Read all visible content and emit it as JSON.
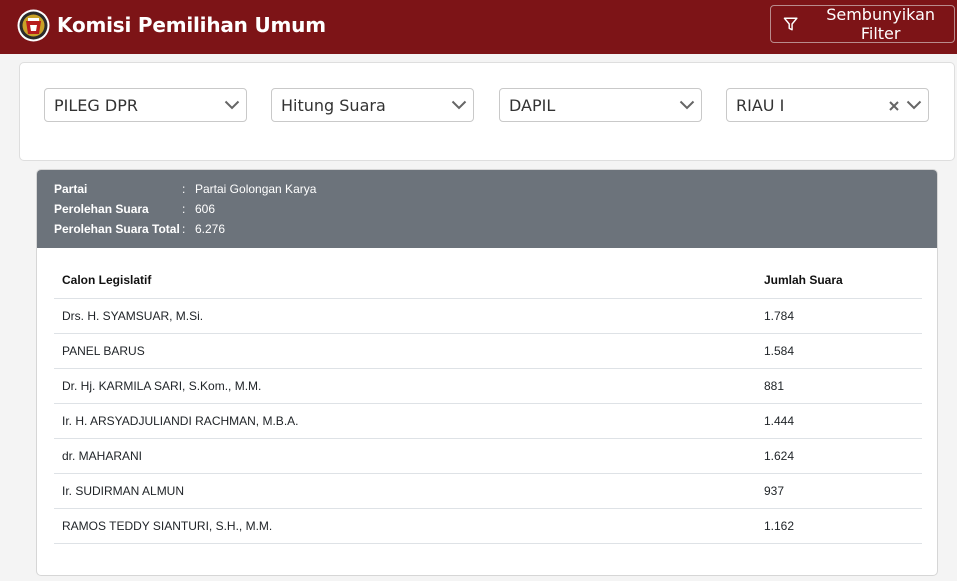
{
  "header": {
    "brand": "Komisi Pemilihan Umum",
    "filter_button_label": "Sembunyikan Filter"
  },
  "filters": [
    {
      "value": "PILEG DPR",
      "clearable": false
    },
    {
      "value": "Hitung Suara",
      "clearable": false
    },
    {
      "value": "DAPIL",
      "clearable": false
    },
    {
      "value": "RIAU I",
      "clearable": true
    }
  ],
  "summary": {
    "rows": [
      {
        "label": "Partai",
        "value": "Partai Golongan Karya"
      },
      {
        "label": "Perolehan Suara",
        "value": "606"
      },
      {
        "label": "Perolehan Suara Total",
        "value": "6.276"
      }
    ],
    "colon": ":"
  },
  "table": {
    "headers": {
      "name": "Calon Legislatif",
      "votes": "Jumlah Suara"
    },
    "rows": [
      {
        "name": "Drs. H. SYAMSUAR, M.Si.",
        "votes": "1.784"
      },
      {
        "name": "PANEL BARUS",
        "votes": "1.584"
      },
      {
        "name": "Dr. Hj. KARMILA SARI, S.Kom., M.M.",
        "votes": "881"
      },
      {
        "name": "Ir. H. ARSYADJULIANDI RACHMAN, M.B.A.",
        "votes": "1.444"
      },
      {
        "name": "dr. MAHARANI",
        "votes": "1.624"
      },
      {
        "name": "Ir. SUDIRMAN ALMUN",
        "votes": "937"
      },
      {
        "name": "RAMOS TEDDY SIANTURI, S.H., M.M.",
        "votes": "1.162"
      }
    ]
  },
  "colors": {
    "header_bg": "#7d1417",
    "summary_bg": "#6c737b"
  }
}
